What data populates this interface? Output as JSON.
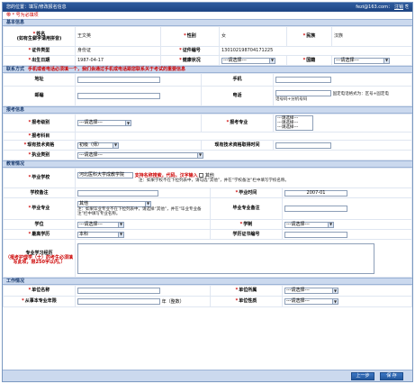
{
  "topbar": {
    "location": "您的位置：填写/修改报名信息",
    "user": "fezi@163.com：",
    "logout": "注销"
  },
  "required_note": "带 * 号为必填项",
  "sections": {
    "basic": "基本信息",
    "contact": "联系方式",
    "contact_note": "手机或者电话必须填一个，我们会通过手机或电话跟您联系关于考试的重要信息",
    "exam": "报考信息",
    "edu": "教育情况",
    "work": "工作情况"
  },
  "basic": {
    "name_label": "姓名",
    "name_sub": "(如有生僻字请用拼音)",
    "name_value": "王文英",
    "gender_label": "性别",
    "gender_value": "女",
    "ethnic_label": "民族",
    "ethnic_value": "汉族",
    "id_type_label": "证件类型",
    "id_type_value": "身份证",
    "id_no_label": "证件编号",
    "id_no_value": "130102198704171225",
    "country_label": "国籍",
    "birth_label": "出生日期",
    "birth_value": "1987-04-17",
    "health_label": "健康状况",
    "health_value": "---请选择---",
    "country_value": "---请选择---"
  },
  "contact": {
    "address_label": "地址",
    "mobile_label": "手机",
    "zip_label": "邮编",
    "phone_label": "电话",
    "phone_hint1": "固定电话格式为：区号+固定电",
    "phone_hint2": "话号码+分机号码"
  },
  "exam": {
    "level_label": "报考级别",
    "level_value": "---请选择---",
    "major_label": "报考专业",
    "major_options": [
      "---请选择---",
      "---请选择---",
      "---请选择---"
    ],
    "subject_label": "报考科目",
    "current_qual_label": "现有技术资格",
    "current_qual_value": "初级（师）",
    "qual_time_label": "现有技术资格取得时间",
    "practice_label": "执业类别",
    "practice_value": "---请选择---"
  },
  "edu": {
    "school_label": "毕业学校",
    "school_value": "河北医科大学成教学院",
    "school_hint": "支持名称搜索，代码，汉字输入",
    "other_label": "其他",
    "school_note": "注：如果学校不在下拉列表中，请勾选“其他”，并在“学校备注”栏中填写学校名称。",
    "school_remark_label": "学校备注",
    "grad_time_label": "毕业时间",
    "grad_time_value": "2007-01",
    "grad_major_label": "毕业专业",
    "grad_major_value": "其他",
    "grad_major_note": "注：如果毕业专业不在下拉列表中，请选择“其他”，并在“毕业专业备注”栏中填写专业名称。",
    "grad_major_remark_label": "毕业专业备注",
    "degree_label": "学位",
    "degree_value": "---请选择---",
    "schooling_label": "学制",
    "schooling_value": "---请选择---",
    "highest_edu_label": "最高学历",
    "highest_edu_value": "本科",
    "cert_no_label": "学历证书编号",
    "exp_label1": "专业学习经历",
    "exp_label2": "（报考护理学（士）的考生必须填写此项，限250字以内。）"
  },
  "work": {
    "unit_name_label": "单位名称",
    "unit_type_label": "单位所属",
    "unit_type_value": "---请选择---",
    "years_label": "从事本专业年限",
    "years_unit": "年（整数）",
    "unit_nature_label": "单位性质",
    "unit_nature_value": "---请选择---"
  },
  "buttons": {
    "prev": "上一步",
    "save": "保 存"
  }
}
